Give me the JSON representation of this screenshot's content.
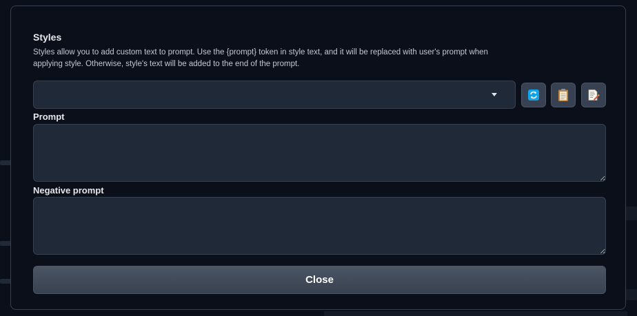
{
  "modal": {
    "title": "Styles",
    "description": "Styles allow you to add custom text to prompt. Use the {prompt} token in style text, and it will be replaced with user's prompt when applying style. Otherwise, style's text will be added to the end of the prompt.",
    "dropdown": {
      "selected_value": ""
    },
    "buttons": {
      "refresh_icon": "refresh-icon",
      "paste_icon": "clipboard-icon",
      "apply_icon": "edit-document-icon"
    },
    "prompt": {
      "label": "Prompt",
      "value": ""
    },
    "negative_prompt": {
      "label": "Negative prompt",
      "value": ""
    },
    "close_label": "Close"
  },
  "colors": {
    "background": "#0b0f19",
    "panel_border": "#374151",
    "input_bg": "#1f2937",
    "refresh_icon_blue": "#0ea5e9",
    "clipboard_brown": "#c0843c"
  }
}
